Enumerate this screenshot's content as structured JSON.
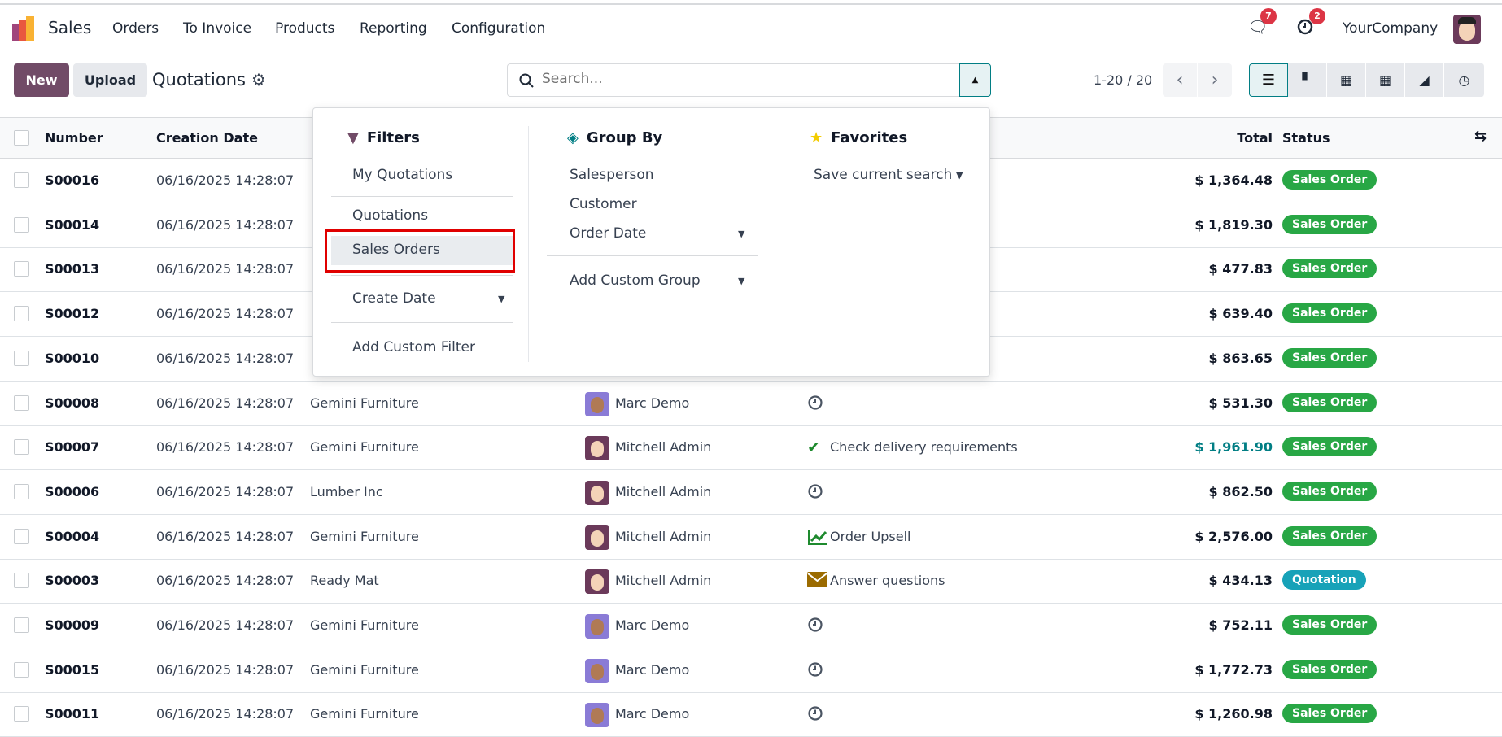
{
  "nav": {
    "app": "Sales",
    "menu": [
      "Orders",
      "To Invoice",
      "Products",
      "Reporting",
      "Configuration"
    ],
    "messages_count": "7",
    "activities_count": "2",
    "company": "YourCompany"
  },
  "control": {
    "new": "New",
    "upload": "Upload",
    "title": "Quotations",
    "search_placeholder": "Search...",
    "pager": "1-20 / 20"
  },
  "columns": {
    "number": "Number",
    "creation_date": "Creation Date",
    "total": "Total",
    "status": "Status"
  },
  "dropdown": {
    "filters": {
      "title": "Filters",
      "items": [
        "My Quotations",
        "Quotations",
        "Sales Orders",
        "Create Date",
        "Add Custom Filter"
      ]
    },
    "group_by": {
      "title": "Group By",
      "items": [
        "Salesperson",
        "Customer",
        "Order Date",
        "Add Custom Group"
      ]
    },
    "favorites": {
      "title": "Favorites",
      "items": [
        "Save current search"
      ]
    }
  },
  "colors": {
    "brand": "#714b67",
    "accent": "#017e84",
    "success": "#28a745",
    "info": "#17a2b8"
  },
  "rows": [
    {
      "number": "S00016",
      "date": "06/16/2025 14:28:07",
      "customer": "",
      "salesperson": "",
      "activity": "",
      "total": "$ 1,364.48",
      "status": "Sales Order"
    },
    {
      "number": "S00014",
      "date": "06/16/2025 14:28:07",
      "customer": "",
      "salesperson": "",
      "activity": "",
      "total": "$ 1,819.30",
      "status": "Sales Order"
    },
    {
      "number": "S00013",
      "date": "06/16/2025 14:28:07",
      "customer": "",
      "salesperson": "",
      "activity": "",
      "total": "$ 477.83",
      "status": "Sales Order"
    },
    {
      "number": "S00012",
      "date": "06/16/2025 14:28:07",
      "customer": "",
      "salesperson": "",
      "activity": "",
      "total": "$ 639.40",
      "status": "Sales Order"
    },
    {
      "number": "S00010",
      "date": "06/16/2025 14:28:07",
      "customer": "",
      "salesperson": "",
      "activity": "",
      "total": "$ 863.65",
      "status": "Sales Order"
    },
    {
      "number": "S00008",
      "date": "06/16/2025 14:28:07",
      "customer": "Gemini Furniture",
      "salesperson": "Marc Demo",
      "activity": "",
      "activity_icon": "clock",
      "total": "$ 531.30",
      "status": "Sales Order"
    },
    {
      "number": "S00007",
      "date": "06/16/2025 14:28:07",
      "customer": "Gemini Furniture",
      "salesperson": "Mitchell Admin",
      "activity": "Check delivery requirements",
      "activity_icon": "check",
      "total": "$ 1,961.90",
      "status": "Sales Order",
      "highlight": true
    },
    {
      "number": "S00006",
      "date": "06/16/2025 14:28:07",
      "customer": "Lumber Inc",
      "salesperson": "Mitchell Admin",
      "activity": "",
      "activity_icon": "clock",
      "total": "$ 862.50",
      "status": "Sales Order"
    },
    {
      "number": "S00004",
      "date": "06/16/2025 14:28:07",
      "customer": "Gemini Furniture",
      "salesperson": "Mitchell Admin",
      "activity": "Order Upsell",
      "activity_icon": "chart",
      "total": "$ 2,576.00",
      "status": "Sales Order"
    },
    {
      "number": "S00003",
      "date": "06/16/2025 14:28:07",
      "customer": "Ready Mat",
      "salesperson": "Mitchell Admin",
      "activity": "Answer questions",
      "activity_icon": "envelope",
      "total": "$ 434.13",
      "status": "Quotation"
    },
    {
      "number": "S00009",
      "date": "06/16/2025 14:28:07",
      "customer": "Gemini Furniture",
      "salesperson": "Marc Demo",
      "activity": "",
      "activity_icon": "clock",
      "total": "$ 752.11",
      "status": "Sales Order"
    },
    {
      "number": "S00015",
      "date": "06/16/2025 14:28:07",
      "customer": "Gemini Furniture",
      "salesperson": "Marc Demo",
      "activity": "",
      "activity_icon": "clock",
      "total": "$ 1,772.73",
      "status": "Sales Order"
    },
    {
      "number": "S00011",
      "date": "06/16/2025 14:28:07",
      "customer": "Gemini Furniture",
      "salesperson": "Marc Demo",
      "activity": "",
      "activity_icon": "clock",
      "total": "$ 1,260.98",
      "status": "Sales Order"
    }
  ]
}
